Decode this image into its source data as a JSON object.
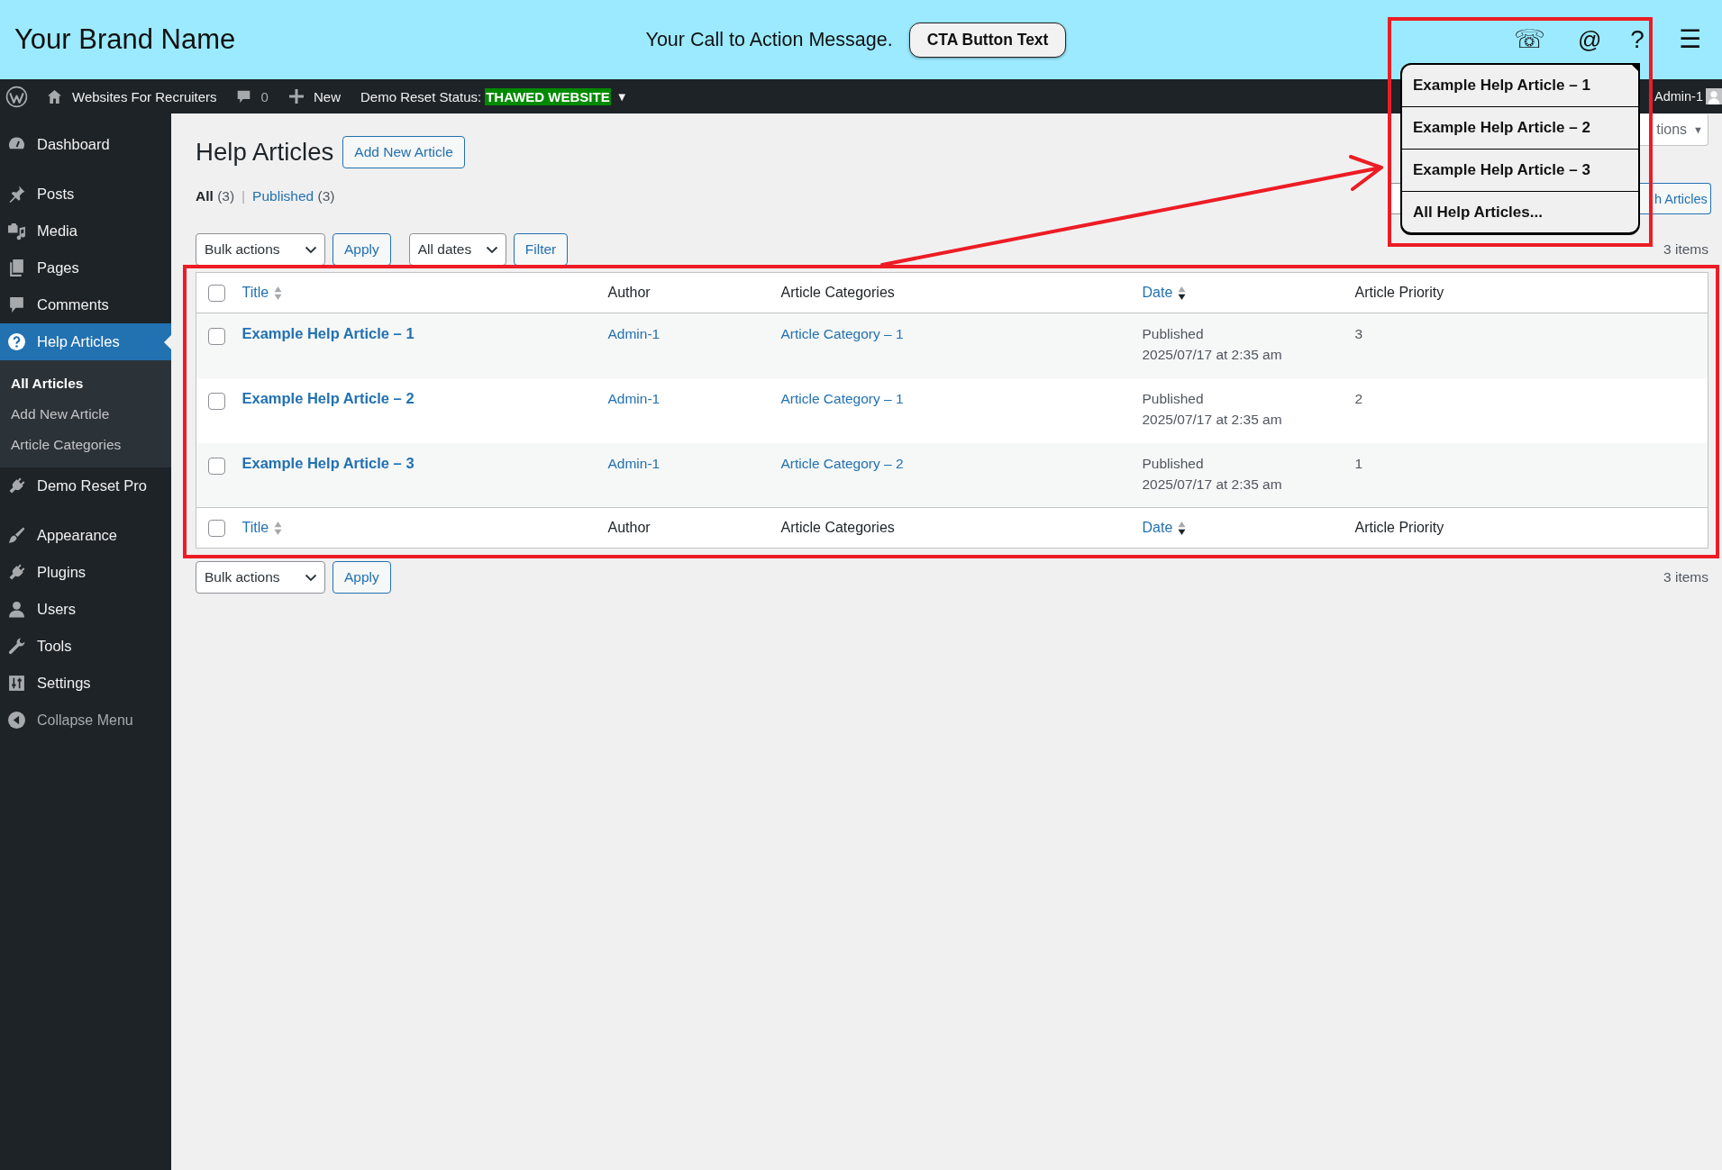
{
  "site_header": {
    "brand": "Your Brand Name",
    "cta_message": "Your Call to Action Message.",
    "cta_button": "CTA Button Text",
    "contact_buttons": [
      {
        "glyph": "☏"
      },
      {
        "glyph": "@"
      },
      {
        "glyph": "?"
      }
    ],
    "menu_glyph": "☰"
  },
  "help_menu": {
    "expanded": true,
    "items": [
      {
        "label": "Example Help Article – 1"
      },
      {
        "label": "Example Help Article – 2"
      },
      {
        "label": "Example Help Article – 3"
      },
      {
        "label": "All Help Articles..."
      }
    ]
  },
  "admin_bar": {
    "site_name": "Websites For Recruiters",
    "comment_count": "0",
    "new_label": "New",
    "status_label": "Demo Reset Status:",
    "status_value": "THAWED WEBSITE",
    "status_caret": "▼",
    "user_name": "Admin-1"
  },
  "sidebar": {
    "groups": [
      {
        "items": [
          {
            "label": "Dashboard",
            "selected": false
          }
        ]
      },
      {
        "items": [
          {
            "label": "Posts",
            "selected": false
          },
          {
            "label": "Media",
            "selected": false
          },
          {
            "label": "Pages",
            "selected": false
          },
          {
            "label": "Comments",
            "selected": false
          },
          {
            "label": "Help Articles",
            "selected": true,
            "children": [
              {
                "label": "All Articles",
                "selected": true
              },
              {
                "label": "Add New Article",
                "selected": false
              },
              {
                "label": "Article Categories",
                "selected": false
              }
            ]
          },
          {
            "label": "Demo Reset Pro",
            "selected": false
          }
        ]
      },
      {
        "items": [
          {
            "label": "Appearance",
            "selected": false
          },
          {
            "label": "Plugins",
            "selected": false
          },
          {
            "label": "Users",
            "selected": false
          },
          {
            "label": "Tools",
            "selected": false
          },
          {
            "label": "Settings",
            "selected": false
          }
        ]
      }
    ],
    "collapse_label": "Collapse Menu"
  },
  "page": {
    "title": "Help Articles",
    "add_button": "Add New Article",
    "screen_options": "tions",
    "screen_options_caret": "▼",
    "views": [
      {
        "label": "All",
        "count": "(3)",
        "selected": true
      },
      {
        "label": "Published",
        "count": "(3)",
        "selected": false
      }
    ],
    "view_separator": "|",
    "search_button": "h Articles"
  },
  "tablenav_top": {
    "bulk_actions": "Bulk actions",
    "apply": "Apply",
    "date_filter": "All dates",
    "filter": "Filter",
    "item_count": "3 items"
  },
  "table": {
    "select_all_checked": false,
    "columns": [
      {
        "label": "Title",
        "sortable": true,
        "sorted": false
      },
      {
        "label": "Author",
        "sortable": false
      },
      {
        "label": "Article Categories",
        "sortable": false
      },
      {
        "label": "Date",
        "sortable": true,
        "sorted": true
      },
      {
        "label": "Article Priority",
        "sortable": false
      }
    ],
    "rows": [
      {
        "checked": false,
        "title": "Example Help Article – 1",
        "author": "Admin-1",
        "category": "Article Category – 1",
        "status": "Published",
        "date": "2025/07/17 at 2:35 am",
        "priority": "3"
      },
      {
        "checked": false,
        "title": "Example Help Article – 2",
        "author": "Admin-1",
        "category": "Article Category – 1",
        "status": "Published",
        "date": "2025/07/17 at 2:35 am",
        "priority": "2"
      },
      {
        "checked": false,
        "title": "Example Help Article – 3",
        "author": "Admin-1",
        "category": "Article Category – 2",
        "status": "Published",
        "date": "2025/07/17 at 2:35 am",
        "priority": "1"
      }
    ],
    "footer_select_all_checked": false,
    "footer_columns": [
      {
        "label": "Title",
        "sortable": true,
        "sorted": false
      },
      {
        "label": "Author",
        "sortable": false
      },
      {
        "label": "Article Categories",
        "sortable": false
      },
      {
        "label": "Date",
        "sortable": true,
        "sorted": true
      },
      {
        "label": "Article Priority",
        "sortable": false
      }
    ]
  },
  "tablenav_bottom": {
    "bulk_actions": "Bulk actions",
    "apply": "Apply",
    "item_count": "3 items"
  },
  "annotations": {
    "menu_frame": true,
    "table_frame": true,
    "arrow": true
  }
}
